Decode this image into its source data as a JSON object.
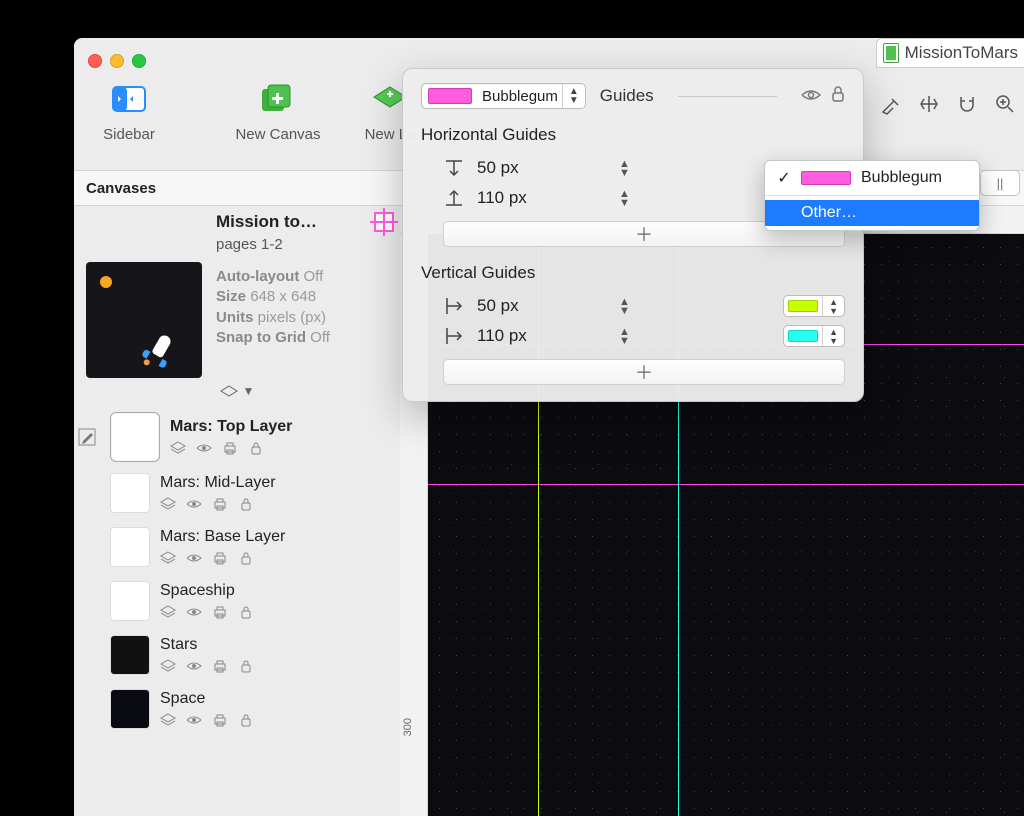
{
  "document": {
    "name": "MissionToMars"
  },
  "toolbar": {
    "sidebar": "Sidebar",
    "new_canvas": "New Canvas",
    "new_layer": "New La"
  },
  "panel": {
    "header": "Canvases",
    "canvas": {
      "title": "Mission to…",
      "pages": "pages 1-2",
      "auto_layout_k": "Auto-layout",
      "auto_layout_v": "Off",
      "size_k": "Size",
      "size_v": "648 x 648",
      "units_k": "Units",
      "units_v": "pixels (px)",
      "snap_k": "Snap to Grid",
      "snap_v": "Off"
    },
    "layers": [
      {
        "name": "Mars: Top Layer",
        "selected": true,
        "swatch": "white"
      },
      {
        "name": "Mars: Mid-Layer",
        "swatch": "white"
      },
      {
        "name": "Mars: Base Layer",
        "swatch": "white"
      },
      {
        "name": "Spaceship",
        "swatch": "white"
      },
      {
        "name": "Stars",
        "swatch": "black"
      },
      {
        "name": "Space",
        "swatch": "space"
      }
    ]
  },
  "ruler": {
    "v_label": "300"
  },
  "popover": {
    "title": "Guides",
    "color_label": "Bubblegum",
    "horizontal": {
      "title": "Horizontal Guides",
      "rows": [
        {
          "value": "50 px"
        },
        {
          "value": "110 px"
        }
      ]
    },
    "vertical": {
      "title": "Vertical Guides",
      "rows": [
        {
          "value": "50 px",
          "color": "lime"
        },
        {
          "value": "110 px",
          "color": "cyan"
        }
      ]
    }
  },
  "menu": {
    "item1": "Bubblegum",
    "item2": "Other…"
  }
}
